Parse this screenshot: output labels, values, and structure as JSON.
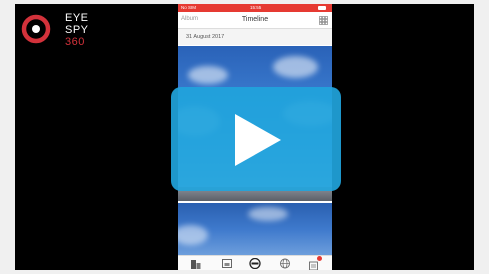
{
  "logo": {
    "line1": "EYE",
    "line2": "SPY",
    "line3": "360",
    "colors": {
      "ring": "#d3323b",
      "text": "#ffffff",
      "accent": "#d3323b"
    }
  },
  "phone": {
    "status_bar": {
      "carrier": "No SIM",
      "time": "15:55",
      "color": "#e63a32"
    },
    "navbar": {
      "left_label": "Album",
      "title": "Timeline",
      "right_icon": "grid-view-icon"
    },
    "date_header": "31 August 2017",
    "tab_bar": {
      "items": [
        {
          "icon": "buildings-icon"
        },
        {
          "icon": "gallery-icon"
        },
        {
          "icon": "camera-lens-icon"
        },
        {
          "icon": "globe-icon"
        },
        {
          "icon": "notifications-icon"
        }
      ]
    }
  },
  "video": {
    "play_icon": "play-icon",
    "accent": "#21a4dc"
  }
}
